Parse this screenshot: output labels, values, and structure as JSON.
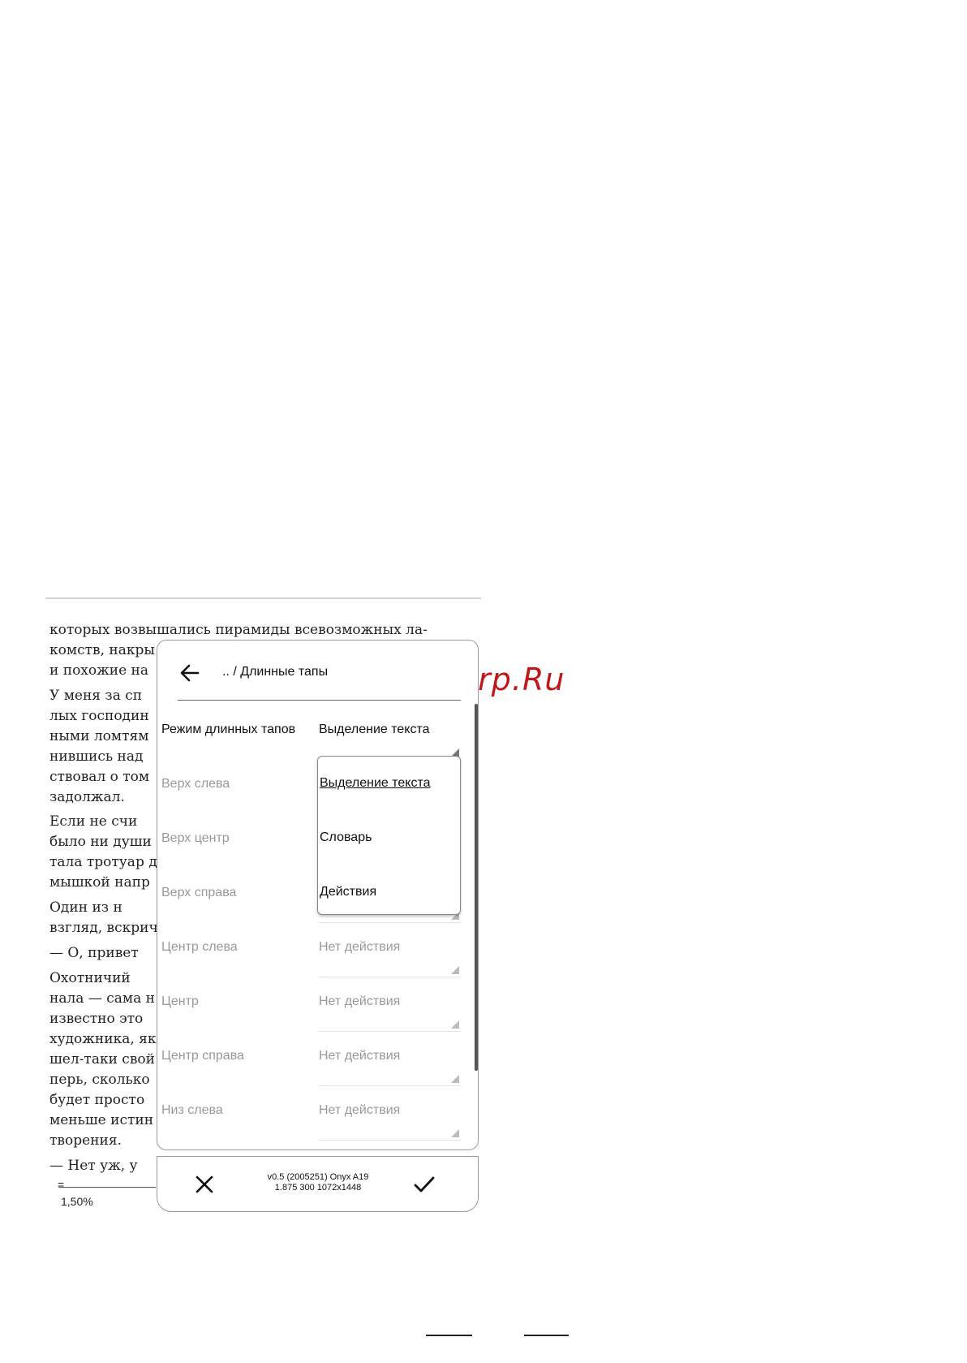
{
  "book": {
    "lines": [
      "которых возвышались пирамиды всевозможных ла-",
      "комств, накры",
      "и похожие на",
      "    У меня за сп",
      "лых господин",
      "ными ломтям",
      "нившись над",
      "ствовал о том",
      "задолжал.",
      "    Если не счи",
      "было ни души",
      "тала тротуар д",
      "мышкой напр",
      "    Один из н",
      "взгляд, вскрич",
      "    — О, привет",
      "    Охотничий",
      "нала — сама н",
      "известно это",
      "художника, як",
      "шел-таки свой",
      "перь, сколько",
      "будет просто",
      "меньше истин",
      "творения.",
      "    — Нет уж, у"
    ],
    "progress_mark": "=",
    "progress": "1,50%"
  },
  "watermark": "McGrp.Ru",
  "dialog": {
    "title": ".. / Длинные тапы",
    "rows": [
      {
        "label": "Режим длинных тапов",
        "value": "Выделение текста"
      },
      {
        "label": "Верх слева",
        "value": ""
      },
      {
        "label": "Верх центр",
        "value": ""
      },
      {
        "label": "Верх справа",
        "value": ""
      },
      {
        "label": "Центр слева",
        "value": "Нет действия"
      },
      {
        "label": "Центр",
        "value": "Нет действия"
      },
      {
        "label": "Центр справа",
        "value": "Нет действия"
      },
      {
        "label": "Низ слева",
        "value": "Нет действия"
      }
    ],
    "dropdown": {
      "options": [
        "Выделение текста",
        "Словарь",
        "Действия"
      ],
      "selected": "Выделение текста"
    }
  },
  "bottom_bar": {
    "version_line1": "v0.5 (2005251) Onyx A19",
    "version_line2": "1.875 300 1072x1448"
  }
}
